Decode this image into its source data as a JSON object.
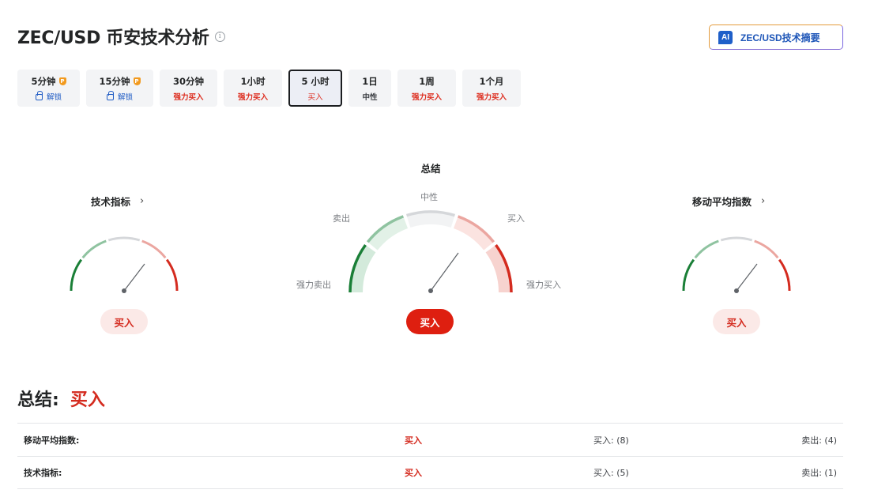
{
  "header": {
    "title": "ZEC/USD 币安技术分析",
    "ai_badge": "AI",
    "ai_button": "ZEC/USD技术摘要"
  },
  "tabs": [
    {
      "label": "5分钟",
      "sub": "解锁",
      "type": "locked",
      "pro": true
    },
    {
      "label": "15分钟",
      "sub": "解锁",
      "type": "locked",
      "pro": true
    },
    {
      "label": "30分钟",
      "sub": "强力买入",
      "type": "buy"
    },
    {
      "label": "1小时",
      "sub": "强力买入",
      "type": "buy"
    },
    {
      "label": "5 小时",
      "sub": "买入",
      "type": "buy",
      "active": true
    },
    {
      "label": "1日",
      "sub": "中性",
      "type": "neutral"
    },
    {
      "label": "1周",
      "sub": "强力买入",
      "type": "buy"
    },
    {
      "label": "1个月",
      "sub": "强力买入",
      "type": "buy"
    }
  ],
  "gauges": {
    "technical": {
      "title": "技术指标",
      "signal": "买入"
    },
    "summary": {
      "title": "总结",
      "signal": "买入",
      "labels": {
        "neutral": "中性",
        "sell": "卖出",
        "buy": "买入",
        "strong_sell": "强力卖出",
        "strong_buy": "强力买入"
      }
    },
    "moving_averages": {
      "title": "移动平均指数",
      "signal": "买入"
    }
  },
  "summary_line": {
    "label": "总结:",
    "value": "买入"
  },
  "table": [
    {
      "name": "移动平均指数:",
      "signal": "买入",
      "buy": "买入: (8)",
      "sell": "卖出: (4)"
    },
    {
      "name": "技术指标:",
      "signal": "买入",
      "buy": "买入: (5)",
      "sell": "卖出: (1)"
    }
  ],
  "colors": {
    "buy": "#d42b1f",
    "sell": "#1a7f37",
    "brand_blue": "#1e56b8"
  }
}
